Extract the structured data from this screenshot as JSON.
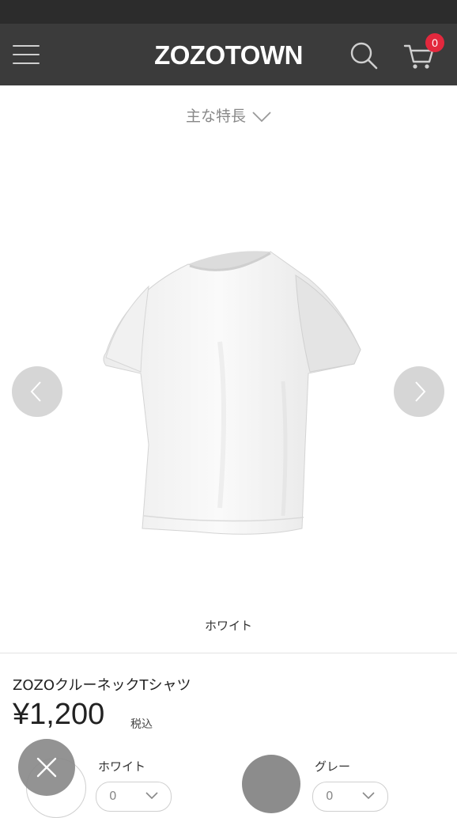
{
  "header": {
    "logo": "ZOZOTOWN",
    "cart_count": "0",
    "colors": {
      "bar": "#3b3b3b",
      "badge": "#e3283d"
    }
  },
  "features": {
    "label": "主な特長"
  },
  "gallery": {
    "image_icon": "white-tshirt-image",
    "prev_icon": "chevron-left-icon",
    "next_icon": "chevron-right-icon",
    "caption": "ホワイト"
  },
  "product": {
    "name": "ZOZOクルーネックTシャツ",
    "price": "¥1,200",
    "tax_label": "税込"
  },
  "variants": [
    {
      "color_name": "ホワイト",
      "quantity": "0",
      "swatch": "#ffffff"
    },
    {
      "color_name": "グレー",
      "quantity": "0",
      "swatch": "#8c8c8c"
    }
  ],
  "close_icon": "close-icon"
}
